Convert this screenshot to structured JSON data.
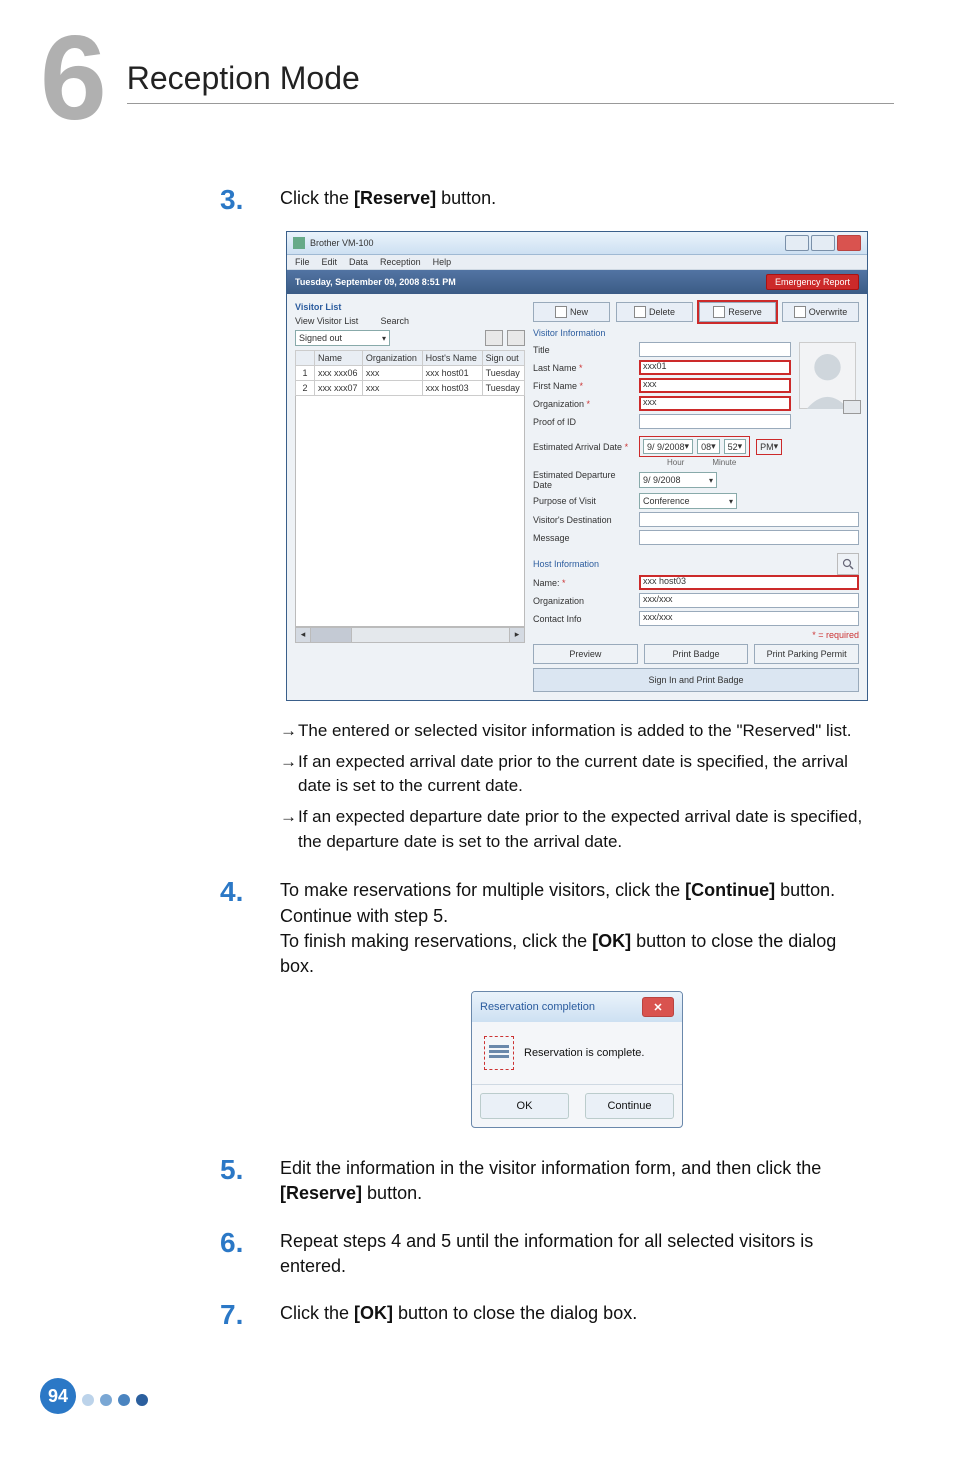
{
  "chapter": {
    "number": "6",
    "title": "Reception Mode"
  },
  "steps": {
    "s3": {
      "num": "3.",
      "text_a": "Click the ",
      "btn": "[Reserve]",
      "text_b": " button."
    },
    "s4": {
      "num": "4.",
      "text_a": "To make reservations for multiple visitors, click the ",
      "btn1": "[Continue]",
      "text_b": " button. Continue with step 5.",
      "text_c": "To finish making reservations, click the ",
      "btn2": "[OK]",
      "text_d": " button to close the dialog box."
    },
    "s5": {
      "num": "5.",
      "text_a": "Edit the information in the visitor information form, and then click the ",
      "btn": "[Reserve]",
      "text_b": " button."
    },
    "s6": {
      "num": "6.",
      "text": "Repeat steps 4 and 5 until the information for all selected visitors is entered."
    },
    "s7": {
      "num": "7.",
      "text_a": "Click the ",
      "btn": "[OK]",
      "text_b": " button to close the dialog box."
    }
  },
  "notes": {
    "n1": "The entered or selected visitor information is added to the \"Reserved\" list.",
    "n2": "If an expected arrival date prior to the current date is specified, the arrival date is set to the current date.",
    "n3": "If an expected departure date prior to the expected arrival date is specified, the departure date is set to the arrival date."
  },
  "window": {
    "title": "Brother VM-100",
    "menubar": [
      "File",
      "Edit",
      "Data",
      "Reception",
      "Help"
    ],
    "datetime": "Tuesday, September 09, 2008 8:51 PM",
    "emergency": "Emergency Report",
    "left": {
      "title": "Visitor List",
      "view_label": "View Visitor List",
      "dropdown": "Signed out",
      "search_label": "Search",
      "columns": [
        "",
        "Name",
        "Organization",
        "Host's Name",
        "Sign out"
      ],
      "rows": [
        {
          "n": "1",
          "name": "xxx xxx06",
          "org": "xxx",
          "host": "xxx host01",
          "signout": "Tuesday"
        },
        {
          "n": "2",
          "name": "xxx xxx07",
          "org": "xxx",
          "host": "xxx host03",
          "signout": "Tuesday"
        }
      ]
    },
    "toolbar": {
      "new": "New",
      "delete": "Delete",
      "reserve": "Reserve",
      "overwrite": "Overwrite"
    },
    "visitor_section": "Visitor Information",
    "host_section": "Host Information",
    "fields": {
      "title": "Title",
      "last_name": "Last Name",
      "first_name": "First Name",
      "organization": "Organization",
      "proof": "Proof of ID",
      "arrival": "Estimated Arrival Date",
      "departure": "Estimated Departure Date",
      "purpose": "Purpose of Visit",
      "destination": "Visitor's Destination",
      "message": "Message",
      "host_name": "Name:",
      "host_org": "Organization",
      "host_contact": "Contact Info"
    },
    "values": {
      "title": "",
      "last_name": "xxx01",
      "first_name": "xxx",
      "organization": "xxx",
      "arrival_date": "9/ 9/2008",
      "arrival_hour": "08",
      "arrival_min": "52",
      "hour_label": "Hour",
      "minute_label": "Minute",
      "pm": "PM",
      "departure_date": "9/ 9/2008",
      "purpose": "Conference",
      "host_name": "xxx host03",
      "host_org": "xxx/xxx",
      "host_contact": "xxx/xxx"
    },
    "required_note": "* = required",
    "bottom": {
      "preview": "Preview",
      "print_badge": "Print Badge",
      "print_parking": "Print Parking Permit",
      "sign_in": "Sign In and Print Badge"
    }
  },
  "dialog": {
    "title": "Reservation completion",
    "message": "Reservation is complete.",
    "ok": "OK",
    "continue": "Continue"
  },
  "footer": {
    "page": "94"
  },
  "chevdown": "▾"
}
